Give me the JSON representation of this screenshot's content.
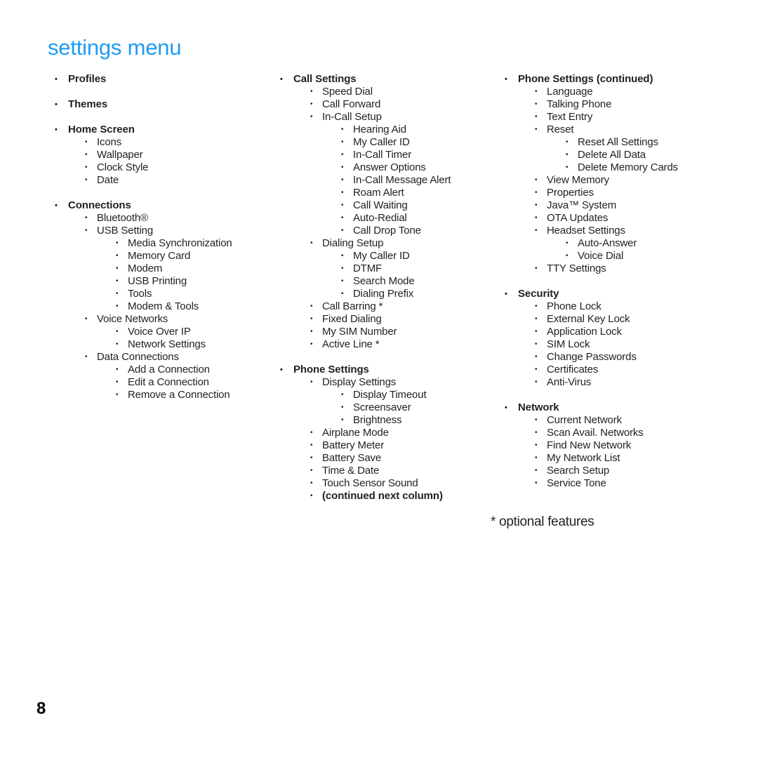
{
  "page": {
    "title": "settings menu",
    "title_color": "#1e9bf5",
    "number": "8",
    "footnote": "* optional features",
    "bullet_glyph": "•"
  },
  "columns": [
    {
      "id": "column-1",
      "blocks": [
        {
          "level": 1,
          "text": "Profiles"
        },
        {
          "level": 1,
          "text": "Themes"
        },
        {
          "level": 1,
          "text": "Home Screen"
        },
        {
          "level": 2,
          "text": "Icons"
        },
        {
          "level": 2,
          "text": "Wallpaper"
        },
        {
          "level": 2,
          "text": "Clock Style"
        },
        {
          "level": 2,
          "text": "Date"
        },
        {
          "level": 1,
          "text": "Connections"
        },
        {
          "level": 2,
          "text": "Bluetooth®"
        },
        {
          "level": 2,
          "text": "USB Setting"
        },
        {
          "level": 3,
          "text": "Media Synchronization"
        },
        {
          "level": 3,
          "text": "Memory Card"
        },
        {
          "level": 3,
          "text": "Modem"
        },
        {
          "level": 3,
          "text": "USB Printing"
        },
        {
          "level": 3,
          "text": "Tools"
        },
        {
          "level": 3,
          "text": "Modem & Tools"
        },
        {
          "level": 2,
          "text": "Voice Networks"
        },
        {
          "level": 3,
          "text": "Voice Over IP"
        },
        {
          "level": 3,
          "text": "Network Settings"
        },
        {
          "level": 2,
          "text": "Data Connections"
        },
        {
          "level": 3,
          "text": "Add a Connection"
        },
        {
          "level": 3,
          "text": "Edit a Connection"
        },
        {
          "level": 3,
          "text": "Remove a Connection"
        }
      ]
    },
    {
      "id": "column-2",
      "blocks": [
        {
          "level": 1,
          "text": "Call Settings"
        },
        {
          "level": 2,
          "text": "Speed Dial"
        },
        {
          "level": 2,
          "text": "Call Forward"
        },
        {
          "level": 2,
          "text": "In-Call Setup"
        },
        {
          "level": 3,
          "text": "Hearing Aid"
        },
        {
          "level": 3,
          "text": "My Caller ID"
        },
        {
          "level": 3,
          "text": "In-Call Timer"
        },
        {
          "level": 3,
          "text": "Answer Options"
        },
        {
          "level": 3,
          "text": "In-Call Message Alert"
        },
        {
          "level": 3,
          "text": "Roam Alert"
        },
        {
          "level": 3,
          "text": "Call Waiting"
        },
        {
          "level": 3,
          "text": "Auto-Redial"
        },
        {
          "level": 3,
          "text": "Call Drop Tone"
        },
        {
          "level": 2,
          "text": "Dialing Setup"
        },
        {
          "level": 3,
          "text": "My Caller ID"
        },
        {
          "level": 3,
          "text": "DTMF"
        },
        {
          "level": 3,
          "text": "Search Mode"
        },
        {
          "level": 3,
          "text": "Dialing Prefix"
        },
        {
          "level": 2,
          "text": "Call Barring *"
        },
        {
          "level": 2,
          "text": "Fixed Dialing"
        },
        {
          "level": 2,
          "text": "My SIM Number"
        },
        {
          "level": 2,
          "text": "Active Line *"
        },
        {
          "level": 1,
          "text": "Phone Settings"
        },
        {
          "level": 2,
          "text": "Display Settings"
        },
        {
          "level": 3,
          "text": "Display Timeout"
        },
        {
          "level": 3,
          "text": "Screensaver"
        },
        {
          "level": 3,
          "text": "Brightness"
        },
        {
          "level": 2,
          "text": "Airplane Mode"
        },
        {
          "level": 2,
          "text": "Battery Meter"
        },
        {
          "level": 2,
          "text": "Battery Save"
        },
        {
          "level": 2,
          "text": "Time & Date"
        },
        {
          "level": 2,
          "text": "Touch Sensor Sound"
        },
        {
          "level": 2,
          "text": "(continued next column)",
          "bold": true
        }
      ]
    },
    {
      "id": "column-3",
      "blocks": [
        {
          "level": 1,
          "text": "Phone Settings (continued)"
        },
        {
          "level": 2,
          "text": "Language"
        },
        {
          "level": 2,
          "text": "Talking Phone"
        },
        {
          "level": 2,
          "text": "Text Entry"
        },
        {
          "level": 2,
          "text": "Reset"
        },
        {
          "level": 3,
          "text": "Reset All Settings"
        },
        {
          "level": 3,
          "text": "Delete All Data"
        },
        {
          "level": 3,
          "text": "Delete Memory Cards"
        },
        {
          "level": 2,
          "text": "View Memory"
        },
        {
          "level": 2,
          "text": "Properties"
        },
        {
          "level": 2,
          "text": "Java™ System"
        },
        {
          "level": 2,
          "text": "OTA Updates"
        },
        {
          "level": 2,
          "text": "Headset Settings"
        },
        {
          "level": 3,
          "text": "Auto-Answer"
        },
        {
          "level": 3,
          "text": "Voice Dial"
        },
        {
          "level": 2,
          "text": "TTY Settings"
        },
        {
          "level": 1,
          "text": "Security"
        },
        {
          "level": 2,
          "text": "Phone Lock"
        },
        {
          "level": 2,
          "text": "External Key Lock"
        },
        {
          "level": 2,
          "text": "Application Lock"
        },
        {
          "level": 2,
          "text": "SIM Lock"
        },
        {
          "level": 2,
          "text": "Change Passwords"
        },
        {
          "level": 2,
          "text": "Certificates"
        },
        {
          "level": 2,
          "text": "Anti-Virus"
        },
        {
          "level": 1,
          "text": "Network"
        },
        {
          "level": 2,
          "text": "Current Network"
        },
        {
          "level": 2,
          "text": "Scan Avail. Networks"
        },
        {
          "level": 2,
          "text": "Find New Network"
        },
        {
          "level": 2,
          "text": "My Network List"
        },
        {
          "level": 2,
          "text": "Search Setup"
        },
        {
          "level": 2,
          "text": "Service Tone"
        }
      ]
    }
  ]
}
